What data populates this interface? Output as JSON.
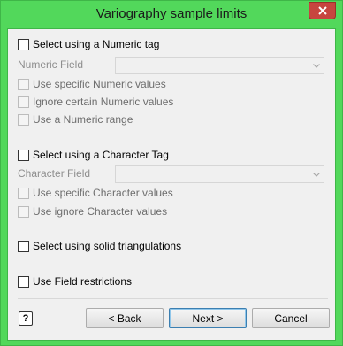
{
  "window": {
    "title": "Variography sample limits"
  },
  "numeric": {
    "select_label": "Select using a Numeric tag",
    "field_label": "Numeric Field",
    "field_value": "",
    "opt_specific": "Use specific Numeric values",
    "opt_ignore": "Ignore certain Numeric values",
    "opt_range": "Use a Numeric range"
  },
  "character": {
    "select_label": "Select using a Character Tag",
    "field_label": "Character Field",
    "field_value": "",
    "opt_specific": "Use specific Character values",
    "opt_ignore": "Use ignore Character values"
  },
  "solid": {
    "select_label": "Select using solid triangulations"
  },
  "restrictions": {
    "select_label": "Use Field restrictions"
  },
  "footer": {
    "help_glyph": "?",
    "back_label": "< Back",
    "next_label": "Next >",
    "cancel_label": "Cancel"
  },
  "colors": {
    "titlebar": "#52d85b",
    "close": "#c7453f",
    "dialog_bg": "#f0f0f0",
    "default_button_border": "#3c7fb1"
  },
  "icons": {
    "close": "close-icon",
    "dropdown": "chevron-down-icon",
    "help": "help-icon"
  }
}
